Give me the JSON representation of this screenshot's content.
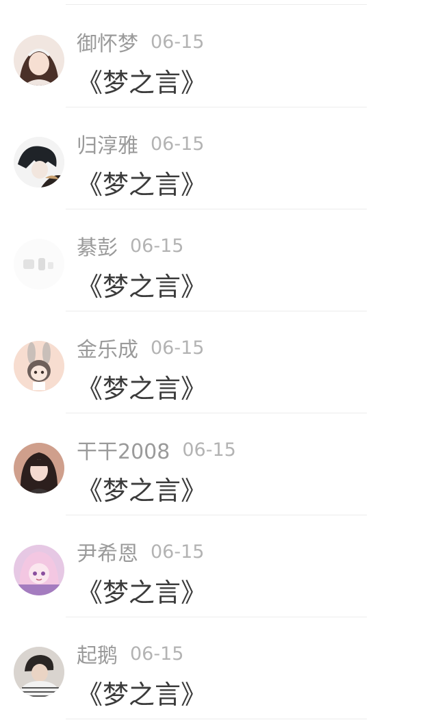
{
  "comments": [
    {
      "name": "御怀梦",
      "date": "06-15",
      "text": "《梦之言》",
      "avatar": "avatar-girl-headband"
    },
    {
      "name": "归淳雅",
      "date": "06-15",
      "text": "《梦之言》",
      "avatar": "avatar-anime-boy-dark"
    },
    {
      "name": "綦彭",
      "date": "06-15",
      "text": "《梦之言》",
      "avatar": "avatar-faded-blank"
    },
    {
      "name": "金乐成",
      "date": "06-15",
      "text": "《梦之言》",
      "avatar": "avatar-chibi-bunny"
    },
    {
      "name": "干干2008",
      "date": "06-15",
      "text": "《梦之言》",
      "avatar": "avatar-girl-long-hair"
    },
    {
      "name": "尹希恩",
      "date": "06-15",
      "text": "《梦之言》",
      "avatar": "avatar-anime-girl-pink"
    },
    {
      "name": "起鹅",
      "date": "06-15",
      "text": "《梦之言》",
      "avatar": "avatar-boy-striped-shirt"
    }
  ]
}
